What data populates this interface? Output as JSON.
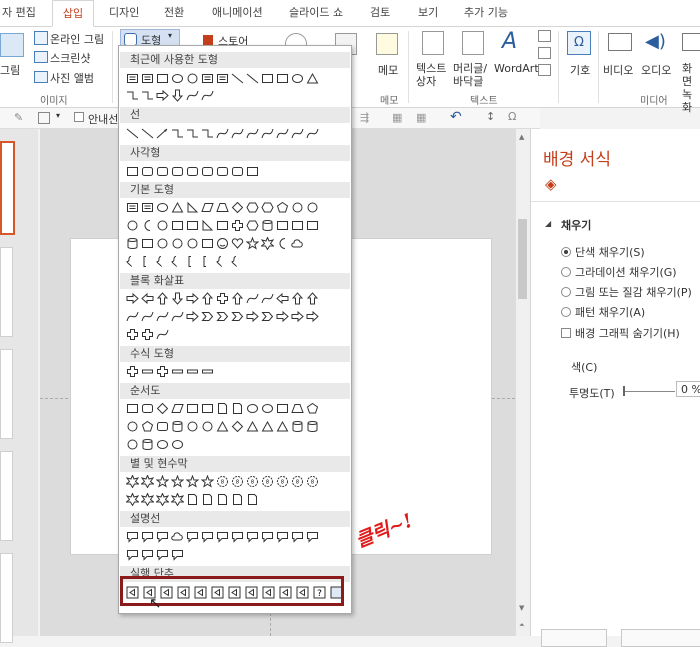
{
  "tabs": [
    "자 편집",
    "삽입",
    "디자인",
    "전환",
    "애니메이션",
    "슬라이드 쇼",
    "검토",
    "보기",
    "추가 기능"
  ],
  "active_tab": "삽입",
  "ribbon": {
    "picture": "그림",
    "online_picture": "온라인 그림",
    "screenshot": "스크린샷",
    "photo_album": "사진 앨범",
    "images_group": "이미지",
    "shapes_button": "도형",
    "smartart": "스토어",
    "comment": "메모",
    "comment_group": "메모",
    "textbox": "텍스트 상자",
    "header_footer": "머리글/ 바닥글",
    "wordart": "WordArt",
    "text_group": "텍스트",
    "symbol": "기호",
    "video": "비디오",
    "audio": "오디오",
    "screen_record": "화면 녹화",
    "media_group": "미디어"
  },
  "quickbar": {
    "guides_label": "안내선"
  },
  "dropdown": {
    "categories": [
      "최근에 사용한 도형",
      "선",
      "사각형",
      "기본 도형",
      "블록 화살표",
      "수식 도형",
      "순서도",
      "별 및 현수막",
      "설명선",
      "실행 단추"
    ]
  },
  "annotation": "클릭~!",
  "format_pane": {
    "title": "배경 서식",
    "section": "채우기",
    "options": [
      "단색 채우기(S)",
      "그라데이션 채우기(G)",
      "그림 또는 질감 채우기(P)",
      "패턴 채우기(A)"
    ],
    "hide_graphics": "배경 그래픽 숨기기(H)",
    "color_label": "색(C)",
    "transparency_label": "투명도(T)",
    "transparency_value": "0 %"
  },
  "colors": {
    "accent": "#c43e1c",
    "highlight": "#8b1a1a",
    "annotation": "#e01b1b"
  }
}
